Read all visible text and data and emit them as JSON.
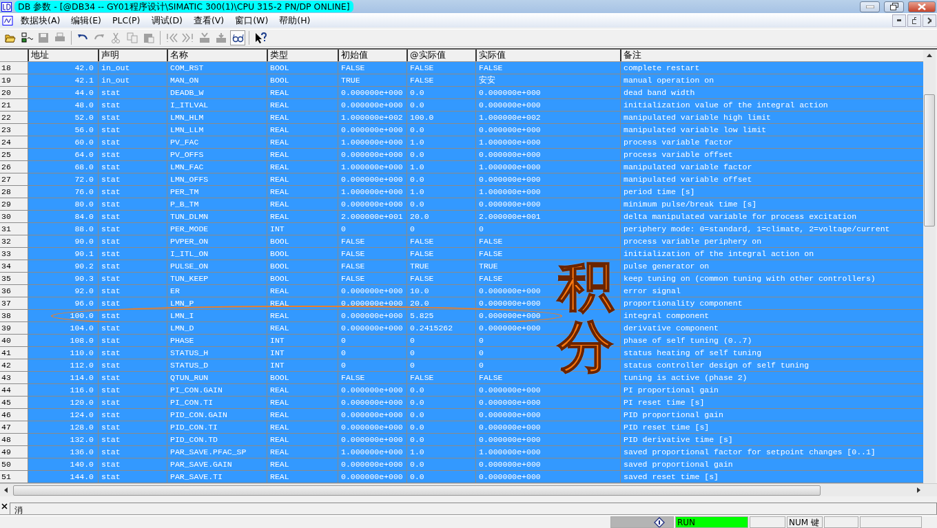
{
  "window": {
    "title": "DB 参数 - [@DB34 -- GY01程序设计\\SIMATIC 300(1)\\CPU 315-2 PN/DP  ONLINE]"
  },
  "menu": [
    "数据块(A)",
    "编辑(E)",
    "PLC(P)",
    "调试(D)",
    "查看(V)",
    "窗口(W)",
    "帮助(H)"
  ],
  "toolbar": [
    {
      "kind": "open",
      "disabled": false,
      "pressed": false
    },
    {
      "kind": "nodes",
      "disabled": false,
      "pressed": false
    },
    {
      "kind": "save",
      "disabled": true,
      "pressed": false
    },
    {
      "kind": "print",
      "disabled": true,
      "pressed": false
    },
    {
      "kind": "sep"
    },
    {
      "kind": "undo",
      "disabled": false,
      "pressed": false
    },
    {
      "kind": "redo",
      "disabled": true,
      "pressed": false
    },
    {
      "kind": "cut",
      "disabled": true,
      "pressed": false
    },
    {
      "kind": "copy",
      "disabled": true,
      "pressed": false
    },
    {
      "kind": "paste",
      "disabled": true,
      "pressed": false
    },
    {
      "kind": "sep"
    },
    {
      "kind": "first",
      "disabled": true,
      "pressed": false
    },
    {
      "kind": "last",
      "disabled": true,
      "pressed": false
    },
    {
      "kind": "upload",
      "disabled": true,
      "pressed": false
    },
    {
      "kind": "download",
      "disabled": true,
      "pressed": false
    },
    {
      "kind": "monitor",
      "disabled": false,
      "pressed": true
    },
    {
      "kind": "sep"
    },
    {
      "kind": "help",
      "disabled": false,
      "pressed": false
    }
  ],
  "table": {
    "columns": [
      "地址",
      "声明",
      "名称",
      "类型",
      "初始值",
      "@实际值",
      "实际值",
      "备注"
    ],
    "rows": [
      {
        "number": "18",
        "cells": [
          "42.0",
          "in_out",
          "COM_RST",
          "BOOL",
          "FALSE",
          "FALSE",
          "FALSE",
          "complete restart"
        ],
        "selected": true,
        "circled": false
      },
      {
        "number": "19",
        "cells": [
          "42.1",
          "in_out",
          "MAN_ON",
          "BOOL",
          "TRUE",
          "FALSE",
          "安安",
          "manual operation on"
        ],
        "selected": true,
        "circled": false
      },
      {
        "number": "20",
        "cells": [
          "44.0",
          "stat",
          "DEADB_W",
          "REAL",
          "0.000000e+000",
          "0.0",
          "0.000000e+000",
          "dead band width"
        ],
        "selected": true,
        "circled": false
      },
      {
        "number": "21",
        "cells": [
          "48.0",
          "stat",
          "I_ITLVAL",
          "REAL",
          "0.000000e+000",
          "0.0",
          "0.000000e+000",
          "initialization value of the integral action"
        ],
        "selected": true,
        "circled": false
      },
      {
        "number": "22",
        "cells": [
          "52.0",
          "stat",
          "LMN_HLM",
          "REAL",
          "1.000000e+002",
          "100.0",
          "1.000000e+002",
          "manipulated variable high limit"
        ],
        "selected": true,
        "circled": false
      },
      {
        "number": "23",
        "cells": [
          "56.0",
          "stat",
          "LMN_LLM",
          "REAL",
          "0.000000e+000",
          "0.0",
          "0.000000e+000",
          "manipulated variable low limit"
        ],
        "selected": true,
        "circled": false
      },
      {
        "number": "24",
        "cells": [
          "60.0",
          "stat",
          "PV_FAC",
          "REAL",
          "1.000000e+000",
          "1.0",
          "1.000000e+000",
          "process variable factor"
        ],
        "selected": true,
        "circled": false
      },
      {
        "number": "25",
        "cells": [
          "64.0",
          "stat",
          "PV_OFFS",
          "REAL",
          "0.000000e+000",
          "0.0",
          "0.000000e+000",
          "process variable offset"
        ],
        "selected": true,
        "circled": false
      },
      {
        "number": "26",
        "cells": [
          "68.0",
          "stat",
          "LMN_FAC",
          "REAL",
          "1.000000e+000",
          "1.0",
          "1.000000e+000",
          "manipulated variable factor"
        ],
        "selected": true,
        "circled": false
      },
      {
        "number": "27",
        "cells": [
          "72.0",
          "stat",
          "LMN_OFFS",
          "REAL",
          "0.000000e+000",
          "0.0",
          "0.000000e+000",
          "manipulated variable offset"
        ],
        "selected": true,
        "circled": false
      },
      {
        "number": "28",
        "cells": [
          "76.0",
          "stat",
          "PER_TM",
          "REAL",
          "1.000000e+000",
          "1.0",
          "1.000000e+000",
          "period time [s]"
        ],
        "selected": true,
        "circled": false
      },
      {
        "number": "29",
        "cells": [
          "80.0",
          "stat",
          "P_B_TM",
          "REAL",
          "0.000000e+000",
          "0.0",
          "0.000000e+000",
          "minimum pulse/break time [s]"
        ],
        "selected": true,
        "circled": false
      },
      {
        "number": "30",
        "cells": [
          "84.0",
          "stat",
          "TUN_DLMN",
          "REAL",
          "2.000000e+001",
          "20.0",
          "2.000000e+001",
          "delta manipulated variable for process excitation"
        ],
        "selected": true,
        "circled": false
      },
      {
        "number": "31",
        "cells": [
          "88.0",
          "stat",
          "PER_MODE",
          "INT",
          "0",
          "0",
          "0",
          "periphery mode: 0=standard, 1=climate, 2=voltage/current"
        ],
        "selected": true,
        "circled": false
      },
      {
        "number": "32",
        "cells": [
          "90.0",
          "stat",
          "PVPER_ON",
          "BOOL",
          "FALSE",
          "FALSE",
          "FALSE",
          "process variable periphery on"
        ],
        "selected": true,
        "circled": false
      },
      {
        "number": "33",
        "cells": [
          "90.1",
          "stat",
          "I_ITL_ON",
          "BOOL",
          "FALSE",
          "FALSE",
          "FALSE",
          "initialization of the integral action on"
        ],
        "selected": true,
        "circled": false
      },
      {
        "number": "34",
        "cells": [
          "90.2",
          "stat",
          "PULSE_ON",
          "BOOL",
          "FALSE",
          "TRUE",
          "TRUE",
          "pulse generator on"
        ],
        "selected": true,
        "circled": false
      },
      {
        "number": "35",
        "cells": [
          "90.3",
          "stat",
          "TUN_KEEP",
          "BOOL",
          "FALSE",
          "FALSE",
          "FALSE",
          "keep tuning on (common tuning with other controllers)"
        ],
        "selected": true,
        "circled": false
      },
      {
        "number": "36",
        "cells": [
          "92.0",
          "stat",
          "ER",
          "REAL",
          "0.000000e+000",
          "10.0",
          "0.000000e+000",
          "error signal"
        ],
        "selected": true,
        "circled": false
      },
      {
        "number": "37",
        "cells": [
          "96.0",
          "stat",
          "LMN_P",
          "REAL",
          "0.000000e+000",
          "20.0",
          "0.000000e+000",
          "proportionality component"
        ],
        "selected": true,
        "circled": false
      },
      {
        "number": "38",
        "cells": [
          "100.0",
          "stat",
          "LMN_I",
          "REAL",
          "0.000000e+000",
          "5.825",
          "0.000000e+000",
          "integral component"
        ],
        "selected": true,
        "circled": true
      },
      {
        "number": "39",
        "cells": [
          "104.0",
          "stat",
          "LMN_D",
          "REAL",
          "0.000000e+000",
          "0.2415262",
          "0.000000e+000",
          "derivative component"
        ],
        "selected": true,
        "circled": false
      },
      {
        "number": "40",
        "cells": [
          "108.0",
          "stat",
          "PHASE",
          "INT",
          "0",
          "0",
          "0",
          "phase of self tuning (0..7)"
        ],
        "selected": true,
        "circled": false
      },
      {
        "number": "41",
        "cells": [
          "110.0",
          "stat",
          "STATUS_H",
          "INT",
          "0",
          "0",
          "0",
          "status heating of self tuning"
        ],
        "selected": true,
        "circled": false
      },
      {
        "number": "42",
        "cells": [
          "112.0",
          "stat",
          "STATUS_D",
          "INT",
          "0",
          "0",
          "0",
          "status controller design of self tuning"
        ],
        "selected": true,
        "circled": false
      },
      {
        "number": "43",
        "cells": [
          "114.0",
          "stat",
          "QTUN_RUN",
          "BOOL",
          "FALSE",
          "FALSE",
          "FALSE",
          "tuning is active (phase 2)"
        ],
        "selected": true,
        "circled": false
      },
      {
        "number": "44",
        "cells": [
          "116.0",
          "stat",
          "PI_CON.GAIN",
          "REAL",
          "0.000000e+000",
          "0.0",
          "0.000000e+000",
          "PI proportional gain"
        ],
        "selected": true,
        "circled": false
      },
      {
        "number": "45",
        "cells": [
          "120.0",
          "stat",
          "PI_CON.TI",
          "REAL",
          "0.000000e+000",
          "0.0",
          "0.000000e+000",
          "PI reset time [s]"
        ],
        "selected": true,
        "circled": false
      },
      {
        "number": "46",
        "cells": [
          "124.0",
          "stat",
          "PID_CON.GAIN",
          "REAL",
          "0.000000e+000",
          "0.0",
          "0.000000e+000",
          "PID proportional gain"
        ],
        "selected": true,
        "circled": false
      },
      {
        "number": "47",
        "cells": [
          "128.0",
          "stat",
          "PID_CON.TI",
          "REAL",
          "0.000000e+000",
          "0.0",
          "0.000000e+000",
          "PID reset time [s]"
        ],
        "selected": true,
        "circled": false
      },
      {
        "number": "48",
        "cells": [
          "132.0",
          "stat",
          "PID_CON.TD",
          "REAL",
          "0.000000e+000",
          "0.0",
          "0.000000e+000",
          "PID derivative time [s]"
        ],
        "selected": true,
        "circled": false
      },
      {
        "number": "49",
        "cells": [
          "136.0",
          "stat",
          "PAR_SAVE.PFAC_SP",
          "REAL",
          "1.000000e+000",
          "1.0",
          "1.000000e+000",
          "saved proportional factor for setpoint changes [0..1]"
        ],
        "selected": true,
        "circled": false
      },
      {
        "number": "50",
        "cells": [
          "140.0",
          "stat",
          "PAR_SAVE.GAIN",
          "REAL",
          "0.000000e+000",
          "0.0",
          "0.000000e+000",
          "saved proportional gain"
        ],
        "selected": true,
        "circled": false
      },
      {
        "number": "51",
        "cells": [
          "144.0",
          "stat",
          "PAR_SAVE.TI",
          "REAL",
          "0.000000e+000",
          "0.0",
          "0.000000e+000",
          "saved reset time [s]"
        ],
        "selected": true,
        "circled": false
      }
    ]
  },
  "annotation": {
    "text": "积分"
  },
  "message_pane": {
    "tab": "消"
  },
  "status_bar": {
    "mode": "RUN",
    "num_lock": "NUM 键"
  }
}
